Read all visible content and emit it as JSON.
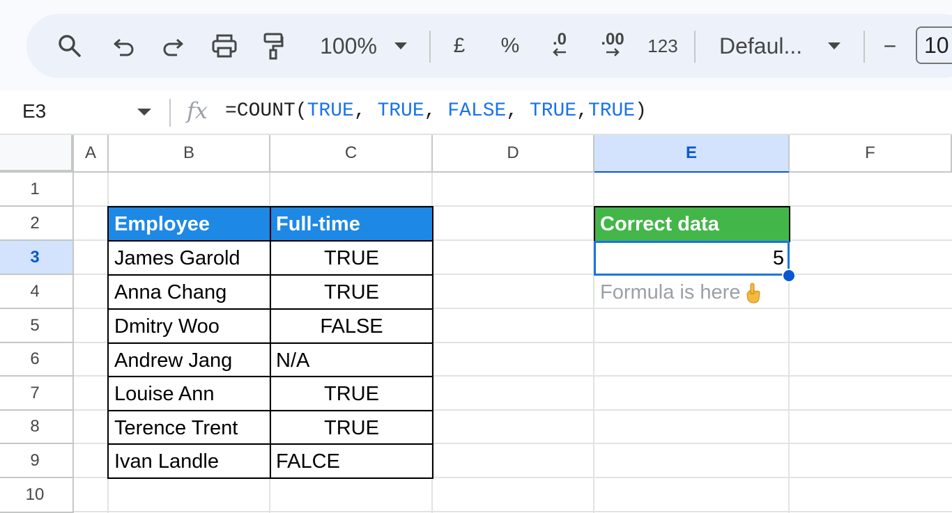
{
  "toolbar": {
    "zoom": "100%",
    "currency": "£",
    "percent": "%",
    "decrease_decimal": ".0",
    "increase_decimal": ".00",
    "number_format": "123",
    "font": "Defaul...",
    "minus": "−",
    "font_size": "10"
  },
  "formula_bar": {
    "name_box": "E3",
    "fx": "fx",
    "formula_prefix": "=COUNT(",
    "args": [
      "TRUE",
      "TRUE",
      "FALSE",
      "TRUE",
      "TRUE"
    ],
    "sep1": ", ",
    "sep2": ", ",
    "sep3": ", ",
    "sep4": ",",
    "formula_suffix": ")"
  },
  "columns": [
    "A",
    "B",
    "C",
    "D",
    "E",
    "F"
  ],
  "selected_column": "E",
  "rows": [
    "1",
    "2",
    "3",
    "4",
    "5",
    "6",
    "7",
    "8",
    "9",
    "10"
  ],
  "selected_row": "3",
  "table": {
    "header": [
      "Employee",
      "Full-time"
    ],
    "rows": [
      [
        "James Garold",
        "TRUE"
      ],
      [
        "Anna Chang",
        "TRUE"
      ],
      [
        "Dmitry Woo",
        "FALSE"
      ],
      [
        "Andrew Jang",
        "N/A"
      ],
      [
        "Louise Ann",
        "TRUE"
      ],
      [
        "Terence Trent",
        "TRUE"
      ],
      [
        "Ivan Landle",
        "FALCE"
      ]
    ]
  },
  "result": {
    "header": "Correct data",
    "value": "5",
    "note": "Formula is here"
  },
  "colors": {
    "table_header": "#1e88e5",
    "result_header": "#43b649",
    "selection": "#1a73e8",
    "formula_keyword": "#1a73e8"
  }
}
